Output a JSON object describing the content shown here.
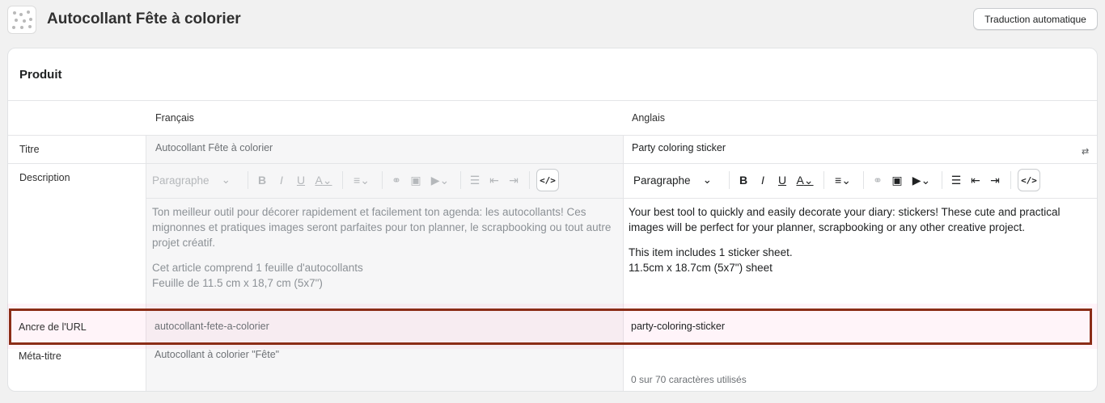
{
  "header": {
    "title": "Autocollant Fête à colorier",
    "auto_translate_label": "Traduction automatique",
    "thumbnail_icon": "product-thumbnail"
  },
  "card": {
    "title": "Produit",
    "columns": {
      "source": "Français",
      "target": "Anglais"
    },
    "rows": {
      "title": {
        "label": "Titre",
        "fr": "Autocollant Fête à colorier",
        "en": "Party coloring sticker"
      },
      "description": {
        "label": "Description",
        "fr_paragraphs": [
          "Ton meilleur outil pour décorer rapidement et facilement ton agenda: les autocollants! Ces mignonnes et pratiques images seront parfaites pour ton planner, le scrapbooking ou tout autre projet créatif.",
          "Cet article comprend 1 feuille d'autocollants\nFeuille de 11.5 cm x 18,7 cm (5x7\")"
        ],
        "en_paragraphs": [
          "Your best tool to quickly and easily decorate your diary: stickers! These cute and practical images will be perfect for your planner, scrapbooking or any other creative project.",
          "This item includes 1 sticker sheet.\n11.5cm x 18.7cm (5x7\") sheet"
        ]
      },
      "url_handle": {
        "label": "Ancre de l'URL",
        "fr": "autocollant-fete-a-colorier",
        "en": "party-coloring-sticker"
      },
      "meta_title": {
        "label": "Méta-titre",
        "fr": "Autocollant à colorier \"Fête\"",
        "en": "",
        "char_count": "0 sur 70 caractères utilisés"
      }
    },
    "toolbar": {
      "paragraph_label": "Paragraphe",
      "bold": "B",
      "italic": "I",
      "underline": "U",
      "text_color": "A",
      "html": "</>"
    }
  },
  "colors": {
    "highlight_border": "#8b2d17",
    "background": "#f1f1f1"
  }
}
